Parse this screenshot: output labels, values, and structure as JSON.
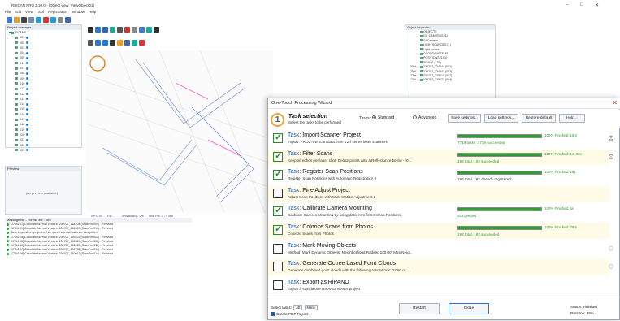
{
  "app": {
    "title": "RISCAN PRO 2.10.0 - [Object view: ViewObject01]",
    "menu": [
      "File",
      "Edit",
      "View",
      "Tool",
      "Registration",
      "Window",
      "Help"
    ],
    "left_panel_title": "Project manager",
    "tree_root": "SCANS",
    "tree_items": [
      "001",
      "002",
      "003",
      "004",
      "005",
      "006",
      "007",
      "008",
      "009",
      "010",
      "011",
      "012",
      "013",
      "014",
      "015",
      "016",
      "017",
      "018",
      "019",
      "020",
      "021",
      "022",
      "023"
    ],
    "preview_title": "Preview",
    "preview_msg": "(no preview available)",
    "message_title": "Message list - Thread list - Info",
    "messages": [
      "[17:54:01] Calculate Normal Vectors: 230707_164408 (ScanPos009) - Finished",
      "[17:54:01] Calculate Normal Vectors: 230707_164629 (ScanPos010) - Finished",
      "Save requested - project will be saved after all tasks are completed",
      "[17:54:05] Calculate Normal Vectors: 230707_165225 (ScanPos005) - Finished",
      "[17:54:06] Calculate Normal Vectors: 230707_165323 (ScanPos006) - Finished",
      "[17:54:06] Calculate Normal Vectors: 230707_165615 (ScanPos012) - Finished",
      "[17:54:07] Calculate Normal Vectors: 230707_165728 (ScanPos013) - Finished",
      "[17:54:08] Calculate Normal Vectors: 230707_170012 (ScanPos014) - Finished"
    ],
    "status_items": [
      "RPS: 50",
      "Dir: -",
      "Antialiasing: Off",
      "Total Pts: 5.75 Mio"
    ],
    "right_panel_title": "Object inspector",
    "right_rows": [
      {
        "pct": "",
        "label": "OBJECTS"
      },
      {
        "pct": "",
        "label": "GL_CAMERAS (1)"
      },
      {
        "pct": "",
        "label": "GLCamera"
      },
      {
        "pct": "",
        "label": "LIGHTSOURCES (1)"
      },
      {
        "pct": "",
        "label": "Light source"
      },
      {
        "pct": "",
        "label": "COORDSYSTEMS"
      },
      {
        "pct": "",
        "label": "POSITIONS (193)"
      },
      {
        "pct": "",
        "label": "SCANS (193)"
      },
      {
        "pct": "25%",
        "label": "230707_134644 (001)"
      },
      {
        "pct": "25%",
        "label": "230707_134841 (002)"
      },
      {
        "pct": "33%",
        "label": "230707_135010 (003)"
      },
      {
        "pct": "42%",
        "label": "230707_135132 (004)"
      }
    ]
  },
  "wizard": {
    "title": "One-Touch Processing Wizard",
    "close_glyph": "✕",
    "logo_glyph": "1",
    "selection_title": "Task selection",
    "selection_subtitle": "Select the tasks to be performed",
    "tasks_label": "Tasks:",
    "mode_standard": "Standard",
    "mode_advanced": "Advanced",
    "btn_save_settings": "Save settings...",
    "btn_load_settings": "Load settings...",
    "btn_restore_default": "Restore default",
    "btn_help": "Help...",
    "task_prefix": "Task:",
    "tasks": [
      {
        "name": "Import Scanner Project",
        "desc": "Import .PRO2 raw scan data from VZ-i series laser scanners",
        "checked": true,
        "progress": 1.0,
        "finish": "100% Finished: 18m",
        "result": "7719 tasks, 7719 succeeded",
        "gear": "normal"
      },
      {
        "name": "Filter Scans",
        "desc": "Keep all echos per laser shot. Delete points with a Reflectance below -20...",
        "checked": true,
        "progress": 1.0,
        "finish": "100% Finished: 1m 36s",
        "result": "193 total, 193 succeeded",
        "gear": "normal"
      },
      {
        "name": "Register Scan Positions",
        "desc": "Register Scan Positions with Automatic Registration 2",
        "checked": true,
        "progress": 1.0,
        "finish": "100% Finished: 19s",
        "result": "192 total, 192 already registered",
        "gear": "none"
      },
      {
        "name": "Fine Adjust Project",
        "desc": "Adjust Scan Positions with Multi Station Adjustment 2",
        "checked": false,
        "progress": null,
        "finish": "",
        "result": "",
        "gear": "none"
      },
      {
        "name": "Calibrate Camera Mounting",
        "desc": "Calibrate Camera Mounting by using data from first 3 Scan Positions",
        "checked": true,
        "progress": 1.0,
        "finish": "100% Finished: 6s",
        "result": "Succeeded",
        "gear": "none"
      },
      {
        "name": "Colorize Scans from Photos",
        "desc": "Colorize Scans from Photos",
        "checked": true,
        "progress": 1.0,
        "finish": "100% Finished: 28m",
        "result": "193 total, 193 succeeded",
        "gear": "none"
      },
      {
        "name": "Mark Moving Objects",
        "desc": "Method: Mark Dynamic Objects, Neighborhood Radius: 100.00, Max Neig...",
        "checked": false,
        "progress": null,
        "finish": "",
        "result": "",
        "gear": "dim"
      },
      {
        "name": "Generate Octree based Point Clouds",
        "desc": "Generate combined point clouds with the following resolutions: 0.050 m, ...",
        "checked": false,
        "progress": null,
        "finish": "",
        "result": "",
        "gear": "dim"
      },
      {
        "name": "Export as RiPANO",
        "desc": "Export a standalone RiPANO Viewer project",
        "checked": false,
        "progress": null,
        "finish": "",
        "result": "",
        "gear": "none"
      }
    ],
    "select_tasks_label": "Select tasks:",
    "btn_all": "All",
    "btn_none": "None",
    "create_pdf": "Create PDF Report",
    "btn_restart": "Restart",
    "btn_close": "Close",
    "status_label": "Status:",
    "status_value": "Finished",
    "runtime_label": "Runtime:",
    "runtime_value": "48m"
  },
  "colors": {
    "progress_green": "#2f9e32",
    "task_link_blue": "#1a4fa0",
    "alt_row_yellow": "#fffbe6"
  }
}
